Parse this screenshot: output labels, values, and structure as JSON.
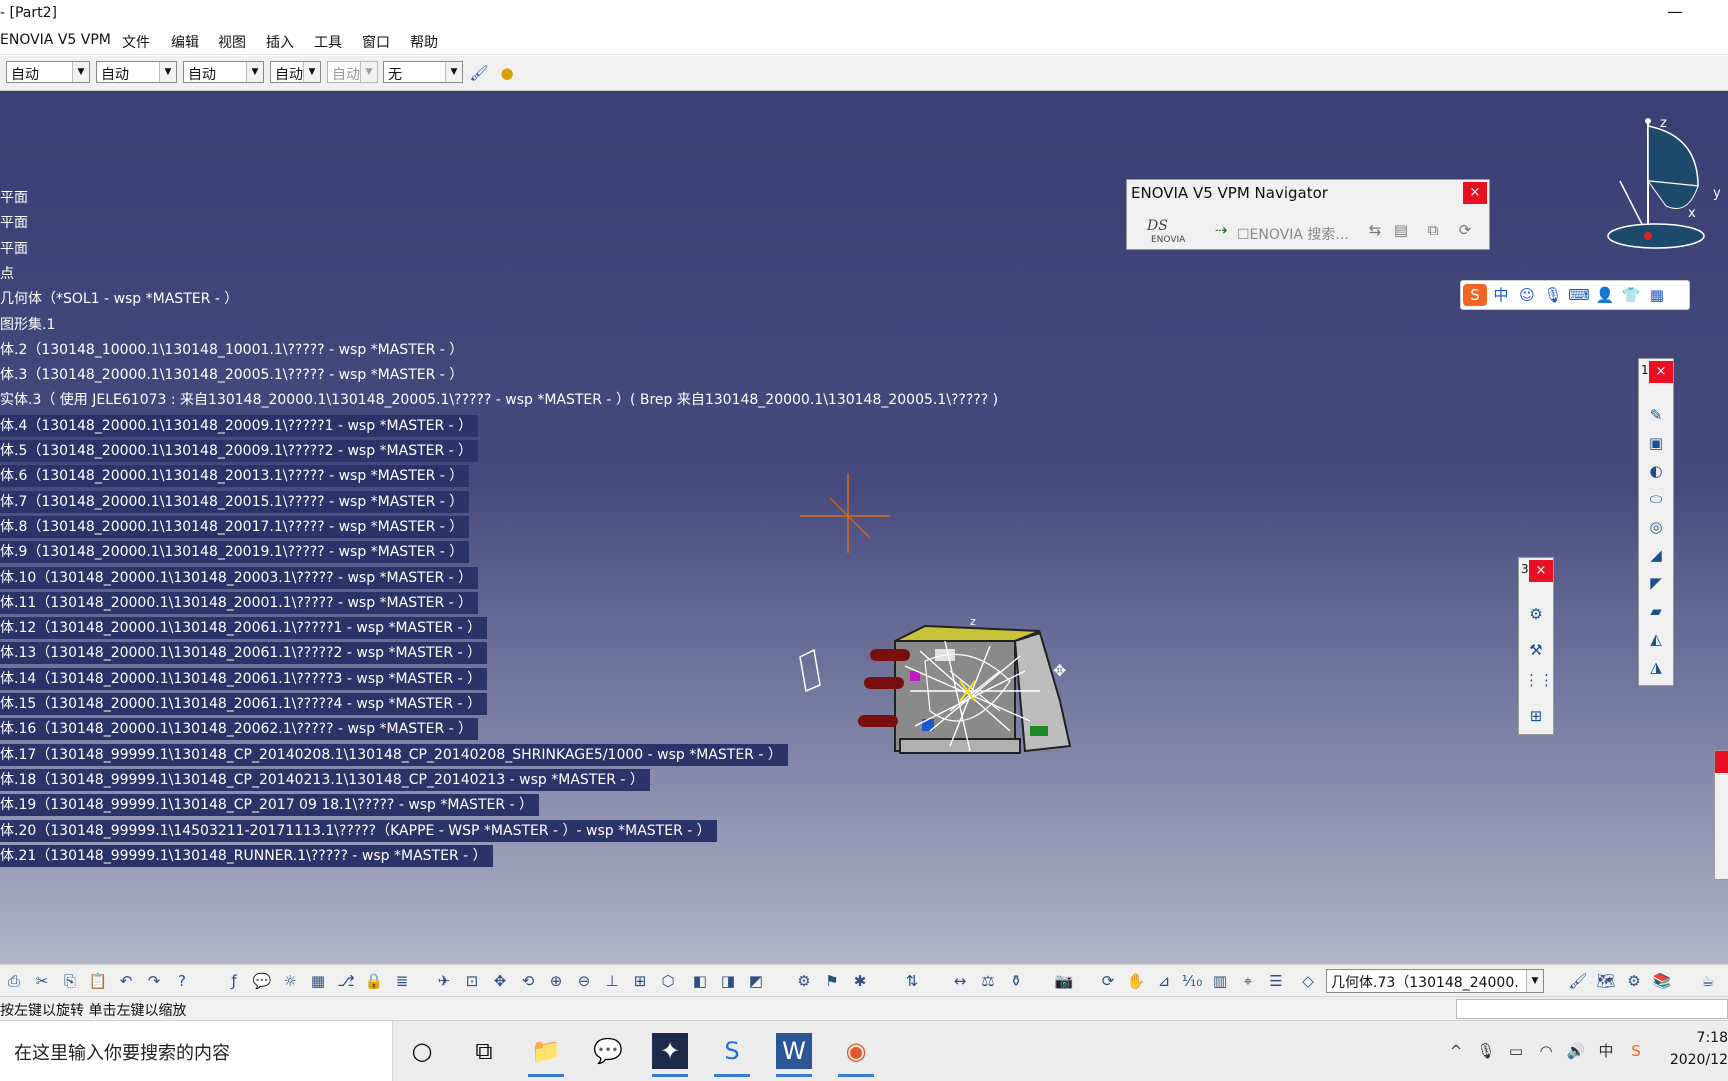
{
  "window": {
    "title": "- [Part2]",
    "minimize_glyph": "—",
    "maximize_glyph": "☐"
  },
  "menu": [
    "ENOVIA V5 VPM",
    "文件",
    "编辑",
    "视图",
    "插入",
    "工具",
    "窗口",
    "帮助"
  ],
  "property_toolbar": {
    "combos": [
      {
        "value": "自动",
        "disabled": false
      },
      {
        "value": "自动",
        "disabled": false
      },
      {
        "value": "自动",
        "disabled": false
      },
      {
        "value": "自动",
        "disabled": false
      },
      {
        "value": "自动",
        "disabled": true
      },
      {
        "value": "无",
        "disabled": false
      }
    ],
    "icons": [
      "paintbrush-icon",
      "sphere-painter-icon"
    ]
  },
  "tree": [
    {
      "text": "平面",
      "selected": false
    },
    {
      "text": "平面",
      "selected": false
    },
    {
      "text": "平面",
      "selected": false
    },
    {
      "text": "点",
      "selected": false
    },
    {
      "text": "几何体（*SOL1 - wsp *MASTER - ）",
      "selected": false
    },
    {
      "text": "图形集.1",
      "selected": false
    },
    {
      "text": "体.2（130148_10000.1\\130148_10001.1\\????? - wsp *MASTER - ）",
      "selected": false
    },
    {
      "text": "体.3（130148_20000.1\\130148_20005.1\\????? - wsp *MASTER - ）",
      "selected": false
    },
    {
      "text": "实体.3（ 使用 JELE61073 : 来自130148_20000.1\\130148_20005.1\\????? - wsp *MASTER - ）( Brep 来自130148_20000.1\\130148_20005.1\\????? )",
      "selected": false
    },
    {
      "text": "体.4（130148_20000.1\\130148_20009.1\\?????1 - wsp *MASTER - ）",
      "selected": true
    },
    {
      "text": "体.5（130148_20000.1\\130148_20009.1\\?????2 - wsp *MASTER - ）",
      "selected": true
    },
    {
      "text": "体.6（130148_20000.1\\130148_20013.1\\????? - wsp *MASTER - ）",
      "selected": true
    },
    {
      "text": "体.7（130148_20000.1\\130148_20015.1\\????? - wsp *MASTER - ）",
      "selected": true
    },
    {
      "text": "体.8（130148_20000.1\\130148_20017.1\\????? - wsp *MASTER - ）",
      "selected": true
    },
    {
      "text": "体.9（130148_20000.1\\130148_20019.1\\????? - wsp *MASTER - ）",
      "selected": true
    },
    {
      "text": "体.10（130148_20000.1\\130148_20003.1\\????? - wsp *MASTER - ）",
      "selected": true
    },
    {
      "text": "体.11（130148_20000.1\\130148_20001.1\\????? - wsp *MASTER - ）",
      "selected": true
    },
    {
      "text": "体.12（130148_20000.1\\130148_20061.1\\?????1 - wsp *MASTER - ）",
      "selected": true
    },
    {
      "text": "体.13（130148_20000.1\\130148_20061.1\\?????2 - wsp *MASTER - ）",
      "selected": true
    },
    {
      "text": "体.14（130148_20000.1\\130148_20061.1\\?????3 - wsp *MASTER - ）",
      "selected": true
    },
    {
      "text": "体.15（130148_20000.1\\130148_20061.1\\?????4 - wsp *MASTER - ）",
      "selected": true
    },
    {
      "text": "体.16（130148_20000.1\\130148_20062.1\\????? - wsp *MASTER - ）",
      "selected": true
    },
    {
      "text": "体.17（130148_99999.1\\130148_CP_20140208.1\\130148_CP_20140208_SHRINKAGE5/1000 - wsp *MASTER - ）",
      "selected": true
    },
    {
      "text": "体.18（130148_99999.1\\130148_CP_20140213.1\\130148_CP_20140213 - wsp *MASTER - ）",
      "selected": true
    },
    {
      "text": "体.19（130148_99999.1\\130148_CP_2017 09 18.1\\????? - wsp *MASTER - ）",
      "selected": true
    },
    {
      "text": "体.20（130148_99999.1\\14503211-20171113.1\\?????（KAPPE - WSP *MASTER - ）- wsp *MASTER - ）",
      "selected": true
    },
    {
      "text": "体.21（130148_99999.1\\130148_RUNNER.1\\????? - wsp *MASTER - ）",
      "selected": true
    }
  ],
  "navigator": {
    "title": "ENOVIA V5 VPM Navigator",
    "close_glyph": "×",
    "search_label": "☐ENOVIA 搜索...",
    "logo_text": "ENOVIA"
  },
  "compass": {
    "x_label": "x",
    "y_label": "y",
    "z_label": "z"
  },
  "model_axis_label": "z",
  "toolbar_titles": {
    "small": "3",
    "right": "1"
  },
  "bottom_toolbar": {
    "current_body": "几何体.73（130148_24000."
  },
  "status": {
    "hint": "按左键以旋转 单击左键以缩放"
  },
  "taskbar": {
    "search_placeholder": "在这里输入你要搜索的内容",
    "time": "7:18",
    "date": "2020/12",
    "ime_label": "中"
  },
  "colors": {
    "viewport_top": "#3a3f73",
    "viewport_bottom": "#b2b4c8",
    "selection": "#2a3468",
    "close_red": "#e81123"
  }
}
